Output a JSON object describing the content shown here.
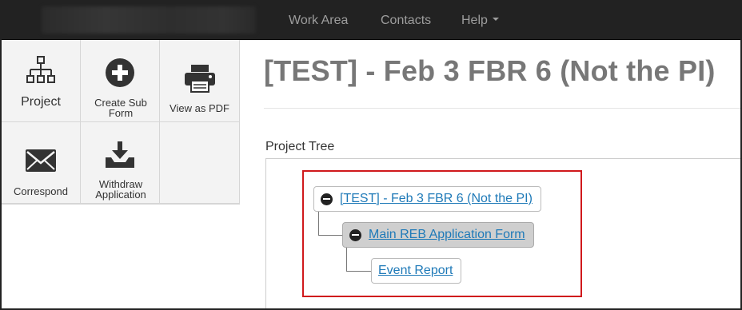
{
  "navbar": {
    "items": [
      {
        "label": "Work Area"
      },
      {
        "label": "Contacts"
      },
      {
        "label": "Help"
      }
    ]
  },
  "sidebar": {
    "tiles": [
      {
        "label": "Project",
        "icon": "sitemap-icon"
      },
      {
        "label": "Create Sub Form",
        "icon": "plus-circle-icon"
      },
      {
        "label": "View as PDF",
        "icon": "print-icon"
      },
      {
        "label": "Correspond",
        "icon": "envelope-icon"
      },
      {
        "label": "Withdraw Application",
        "icon": "download-tray-icon"
      }
    ]
  },
  "main": {
    "page_title": "[TEST] - Feb 3 FBR 6 (Not the PI)",
    "tree_label": "Project Tree",
    "tree": {
      "root": {
        "label": "[TEST] - Feb 3 FBR 6 (Not the PI)"
      },
      "child": {
        "label": "Main REB Application Form",
        "selected": true
      },
      "grandchild": {
        "label": "Event Report"
      }
    }
  },
  "colors": {
    "navbar_bg": "#222222",
    "link": "#1f7ab8",
    "highlight_border": "#d0191c",
    "title": "#777777"
  }
}
